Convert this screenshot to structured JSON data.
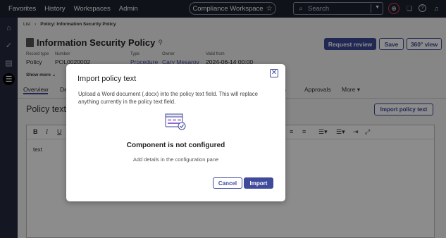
{
  "topnav": {
    "items": [
      "Favorites",
      "History",
      "Workspaces",
      "Admin"
    ],
    "workspace": "Compliance Workspace",
    "search_placeholder": "Search"
  },
  "breadcrumb": {
    "back": "List",
    "current": "Policy: Information Security Policy"
  },
  "record": {
    "title": "Information Security Policy",
    "meta": [
      {
        "label": "Record type",
        "value": "Policy"
      },
      {
        "label": "Number",
        "value": "POL0020002"
      },
      {
        "label": "Type",
        "value": "Procedure"
      },
      {
        "label": "Owner",
        "value": "Cary Mesarov"
      },
      {
        "label": "Valid from",
        "value": "2024-06-14 00:00"
      }
    ],
    "show_more": "Show more"
  },
  "actions": {
    "request_review": "Request review",
    "save": "Save",
    "view_360": "360° view"
  },
  "tabs": [
    "Overview",
    "De",
    "ies",
    "Approvals",
    "More"
  ],
  "section": {
    "title": "Policy text",
    "import_button": "Import policy text",
    "editor_text": "text"
  },
  "modal": {
    "title": "Import policy text",
    "description": "Upload a Word document (.docx) into the policy text field. This will replace anything currently in the policy text field.",
    "heading": "Component is not configured",
    "subtext": "Add details in the configuration pane",
    "cancel": "Cancel",
    "import": "Import"
  },
  "colors": {
    "accent": "#3f4a9a",
    "nav_bg": "#1e2230",
    "rail_bg": "#262b3c"
  }
}
